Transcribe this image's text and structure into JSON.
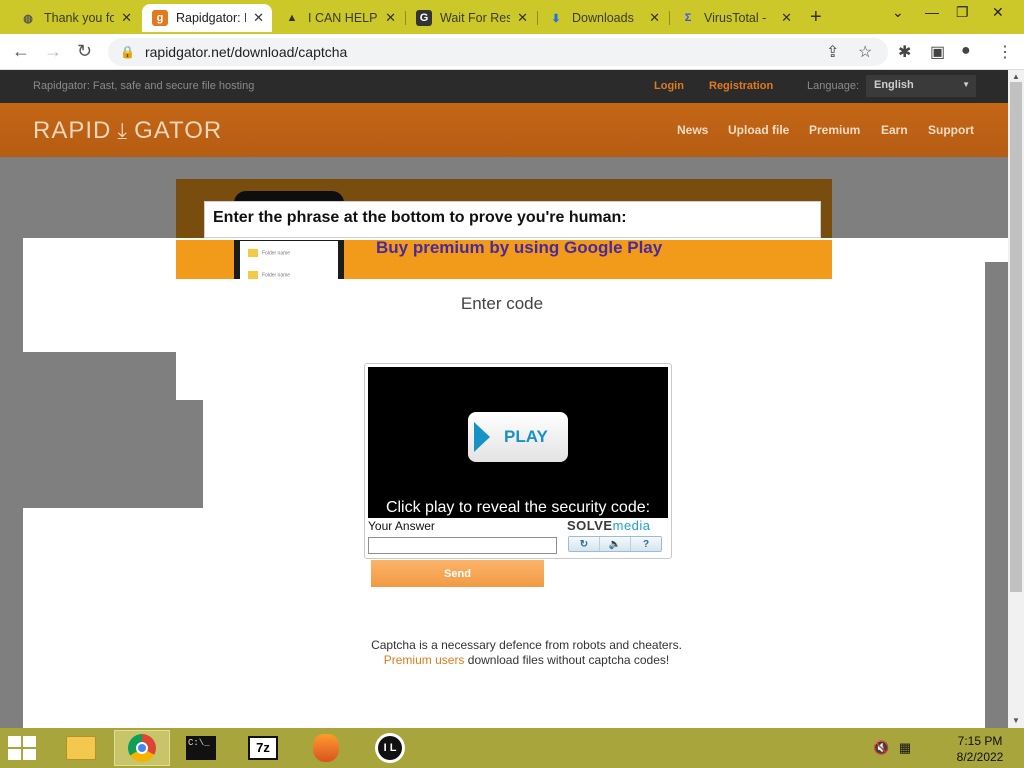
{
  "browser": {
    "tabs": [
      {
        "title": "Thank you fo",
        "icon": "globe-icon"
      },
      {
        "title": "Rapidgator: F",
        "icon": "rapidgator-icon",
        "active": true
      },
      {
        "title": "I CAN HELP",
        "icon": "eagle-icon"
      },
      {
        "title": "Wait For Res",
        "icon": "g-icon"
      },
      {
        "title": "Downloads",
        "icon": "download-icon"
      },
      {
        "title": "VirusTotal -",
        "icon": "virustotal-icon"
      }
    ],
    "url": "rapidgator.net/download/captcha"
  },
  "site": {
    "tagline": "Rapidgator: Fast, safe and secure file hosting",
    "login": "Login",
    "registration": "Registration",
    "language_label": "Language:",
    "language_value": "English",
    "logo_left": "RAPID",
    "logo_right": "GATOR",
    "nav": [
      "News",
      "Upload file",
      "Premium",
      "Earn",
      "Support"
    ]
  },
  "banner": {
    "phone_rows": [
      "Folder name",
      "Folder name"
    ],
    "text": "Buy premium by using Google Play"
  },
  "popup": {
    "title": "Enter the phrase at the bottom to prove you're human:"
  },
  "main": {
    "enter_code": "Enter code",
    "send": "Send",
    "footer_line1": "Captcha is a necessary defence from robots and cheaters.",
    "footer_link": "Premium users",
    "footer_line2_rest": " download files without captcha codes!"
  },
  "captcha": {
    "play": "PLAY",
    "reveal": "Click play to reveal the security code:",
    "answer_label": "Your Answer",
    "answer_value": "",
    "logo_a": "SOLVE",
    "logo_b": "media"
  },
  "taskbar": {
    "apps": [
      "file-explorer-icon",
      "chrome-icon",
      "cmd-icon",
      "7zip-icon",
      "fl-studio-icon",
      "il-icon"
    ],
    "time": "7:15 PM",
    "date": "8/2/2022"
  },
  "colors": {
    "accent": "#e07a1f",
    "header": "#b55d14",
    "tabstrip": "#ccc82a",
    "taskbar": "#a8a53c"
  }
}
